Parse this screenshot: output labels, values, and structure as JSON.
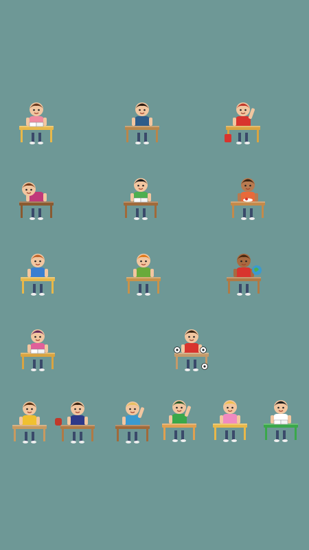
{
  "scene": {
    "background": "#6e9896",
    "students": [
      {
        "id": "girl-reading-book",
        "desk": "#e8b84a",
        "shirt": "#f08aa0",
        "hair": "#6b3a1f",
        "skin": "#f2c6a0",
        "pose": "reading"
      },
      {
        "id": "boy-sitting-blue-shirt",
        "desk": "#b8864b",
        "shirt": "#2e5c8a",
        "hair": "#2b1a10",
        "skin": "#f2c6a0",
        "pose": "sitting"
      },
      {
        "id": "boy-red-shirt-waving",
        "desk": "#d9a441",
        "shirt": "#d8342e",
        "hair": "#c0392b",
        "skin": "#f2c6a0",
        "pose": "waving"
      },
      {
        "id": "boy-sleeping-on-desk",
        "desk": "#8a5a30",
        "shirt": "#c0397a",
        "hair": "#7a3d1a",
        "skin": "#f2c6a0",
        "pose": "sleeping"
      },
      {
        "id": "boy-green-shirt-writing",
        "desk": "#a06a3a",
        "shirt": "#4caf50",
        "hair": "#1a1a1a",
        "skin": "#f2c6a0",
        "pose": "writing"
      },
      {
        "id": "boy-curly-hair-eating",
        "desk": "#c48a4a",
        "shirt": "#e86a3a",
        "hair": "#3a2210",
        "skin": "#b87a50",
        "pose": "eating"
      },
      {
        "id": "girl-blue-dress",
        "desk": "#e8b84a",
        "shirt": "#3a7fd0",
        "hair": "#c0642a",
        "skin": "#f2c6a0",
        "pose": "sitting"
      },
      {
        "id": "boy-orange-hair-green-shirt",
        "desk": "#c8924a",
        "shirt": "#6aaa3a",
        "hair": "#e07a1a",
        "skin": "#f2c6a0",
        "pose": "sitting"
      },
      {
        "id": "boy-with-globe",
        "desk": "#b07a45",
        "shirt": "#d8342e",
        "hair": "#4a2a10",
        "skin": "#a86a40",
        "pose": "globe"
      },
      {
        "id": "girl-pink-writing",
        "desk": "#d9a441",
        "shirt": "#e0609a",
        "hair": "#6b2a5a",
        "skin": "#f2c6a0",
        "pose": "writing"
      },
      {
        "id": "boy-soccer-balls",
        "desk": "#c49a6a",
        "shirt": "#d8342e",
        "hair": "#3a2210",
        "skin": "#f2c6a0",
        "pose": "sitting"
      },
      {
        "id": "boy-yellow-shirt",
        "desk": "#c89a60",
        "shirt": "#f0c030",
        "hair": "#5a3010",
        "skin": "#f2c6a0",
        "pose": "sitting"
      },
      {
        "id": "boy-with-backpack",
        "desk": "#b07a45",
        "shirt": "#2e3a8a",
        "hair": "#3a2210",
        "skin": "#f2c6a0",
        "pose": "sitting"
      },
      {
        "id": "boy-raising-hand",
        "desk": "#a06a3a",
        "shirt": "#3a9ad0",
        "hair": "#e8c060",
        "skin": "#f2c6a0",
        "pose": "waving"
      },
      {
        "id": "boy-green-cap-books",
        "desk": "#e0a050",
        "shirt": "#3aa84a",
        "hair": "#2a5a2a",
        "skin": "#f2c6a0",
        "pose": "waving"
      },
      {
        "id": "girl-blonde-pink",
        "desk": "#e8b84a",
        "shirt": "#f08ac0",
        "hair": "#f0c050",
        "skin": "#f2c6a0",
        "pose": "sitting"
      },
      {
        "id": "boy-open-book-smiling",
        "desk": "#3aa84a",
        "shirt": "#ffffff",
        "hair": "#1a1a1a",
        "skin": "#f2c6a0",
        "pose": "reading"
      }
    ]
  }
}
